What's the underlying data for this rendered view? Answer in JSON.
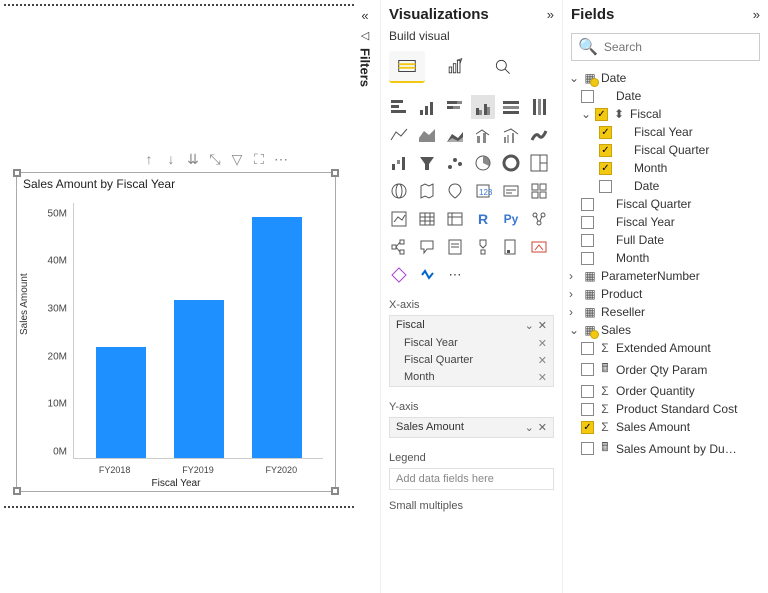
{
  "chart_data": {
    "type": "bar",
    "title": "Sales Amount by Fiscal Year",
    "categories": [
      "FY2018",
      "FY2019",
      "FY2020"
    ],
    "values": [
      24000000,
      34000000,
      52000000
    ],
    "xlabel": "Fiscal Year",
    "ylabel": "Sales Amount",
    "ylim": [
      0,
      55000000
    ],
    "yticks": [
      "0M",
      "10M",
      "20M",
      "30M",
      "40M",
      "50M"
    ]
  },
  "filters": {
    "label": "Filters"
  },
  "viz": {
    "title": "Visualizations",
    "subtitle": "Build visual",
    "wells": {
      "xaxis": {
        "label": "X-axis",
        "group": "Fiscal",
        "items": [
          "Fiscal Year",
          "Fiscal Quarter",
          "Month"
        ]
      },
      "yaxis": {
        "label": "Y-axis",
        "item": "Sales Amount"
      },
      "legend": {
        "label": "Legend",
        "placeholder": "Add data fields here"
      },
      "small": {
        "label": "Small multiples"
      }
    }
  },
  "fields": {
    "title": "Fields",
    "search_placeholder": "Search",
    "tables": {
      "date": {
        "name": "Date",
        "cols": {
          "date": "Date"
        },
        "fiscal": {
          "name": "Fiscal",
          "children": {
            "fy": "Fiscal Year",
            "fq": "Fiscal Quarter",
            "m": "Month",
            "d": "Date"
          }
        },
        "extra": {
          "fq": "Fiscal Quarter",
          "fy": "Fiscal Year",
          "fd": "Full Date",
          "m": "Month"
        }
      },
      "param": "ParameterNumber",
      "product": "Product",
      "reseller": "Reseller",
      "sales": {
        "name": "Sales",
        "cols": {
          "ext": "Extended Amount",
          "oqp": "Order Qty Param",
          "oq": "Order Quantity",
          "psc": "Product Standard Cost",
          "sa": "Sales Amount",
          "sabd": "Sales Amount by Du…"
        }
      }
    }
  }
}
